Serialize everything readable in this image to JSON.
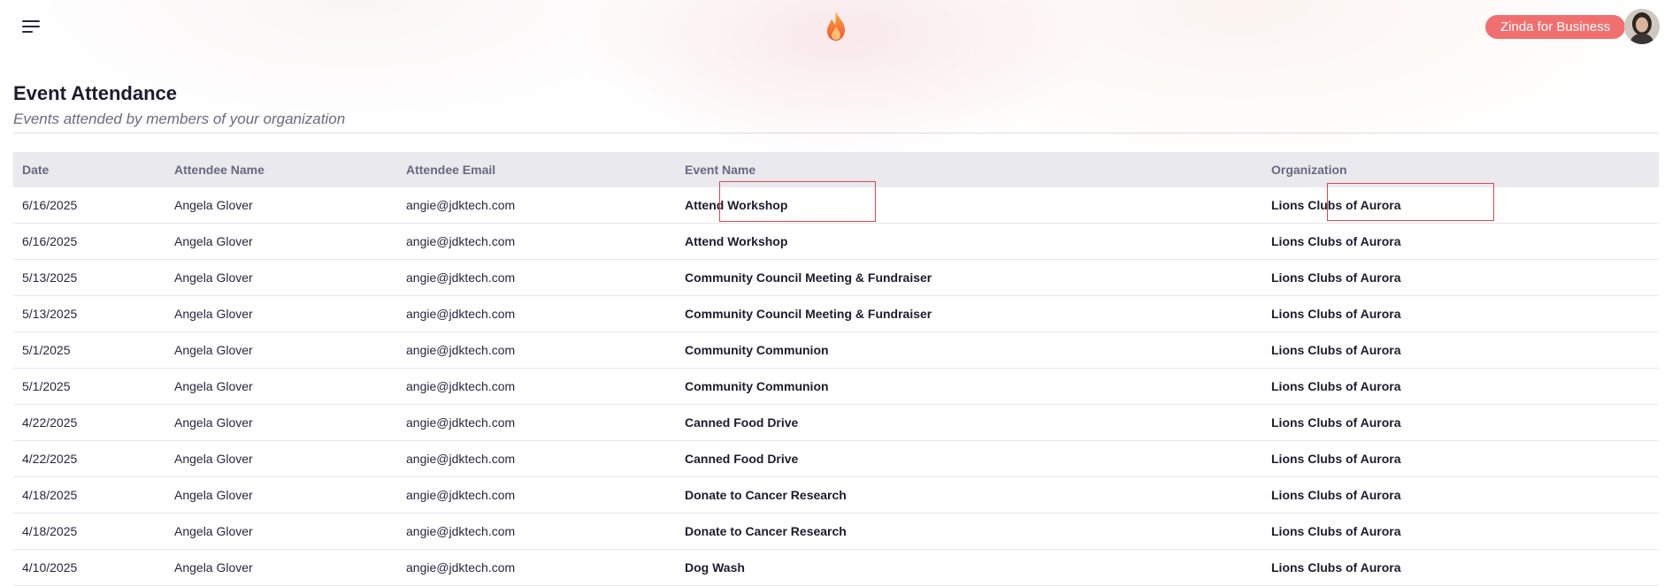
{
  "header": {
    "business_button": "Zinda for Business"
  },
  "page": {
    "title": "Event Attendance",
    "subtitle": "Events attended by members of your organization"
  },
  "table": {
    "columns": [
      "Date",
      "Attendee Name",
      "Attendee Email",
      "Event Name",
      "Organization"
    ],
    "rows": [
      {
        "date": "6/16/2025",
        "name": "Angela Glover",
        "email": "angie@jdktech.com",
        "event": "Attend Workshop",
        "org": "Lions Clubs of Aurora"
      },
      {
        "date": "6/16/2025",
        "name": "Angela Glover",
        "email": "angie@jdktech.com",
        "event": "Attend Workshop",
        "org": "Lions Clubs of Aurora"
      },
      {
        "date": "5/13/2025",
        "name": "Angela Glover",
        "email": "angie@jdktech.com",
        "event": "Community Council Meeting & Fundraiser",
        "org": "Lions Clubs of Aurora"
      },
      {
        "date": "5/13/2025",
        "name": "Angela Glover",
        "email": "angie@jdktech.com",
        "event": "Community Council Meeting & Fundraiser",
        "org": "Lions Clubs of Aurora"
      },
      {
        "date": "5/1/2025",
        "name": "Angela Glover",
        "email": "angie@jdktech.com",
        "event": "Community Communion",
        "org": "Lions Clubs of Aurora"
      },
      {
        "date": "5/1/2025",
        "name": "Angela Glover",
        "email": "angie@jdktech.com",
        "event": "Community Communion",
        "org": "Lions Clubs of Aurora"
      },
      {
        "date": "4/22/2025",
        "name": "Angela Glover",
        "email": "angie@jdktech.com",
        "event": "Canned Food Drive",
        "org": "Lions Clubs of Aurora"
      },
      {
        "date": "4/22/2025",
        "name": "Angela Glover",
        "email": "angie@jdktech.com",
        "event": "Canned Food Drive",
        "org": "Lions Clubs of Aurora"
      },
      {
        "date": "4/18/2025",
        "name": "Angela Glover",
        "email": "angie@jdktech.com",
        "event": "Donate to Cancer Research",
        "org": "Lions Clubs of Aurora"
      },
      {
        "date": "4/18/2025",
        "name": "Angela Glover",
        "email": "angie@jdktech.com",
        "event": "Donate to Cancer Research",
        "org": "Lions Clubs of Aurora"
      },
      {
        "date": "4/10/2025",
        "name": "Angela Glover",
        "email": "angie@jdktech.com",
        "event": "Dog Wash",
        "org": "Lions Clubs of Aurora"
      }
    ]
  },
  "icons": {
    "menu": "menu-icon",
    "logo": "flame-logo-icon",
    "avatar": "user-avatar"
  },
  "colors": {
    "accent": "#f26f6f",
    "header_bg": "#e9e9ee",
    "highlight": "#e0484c"
  }
}
